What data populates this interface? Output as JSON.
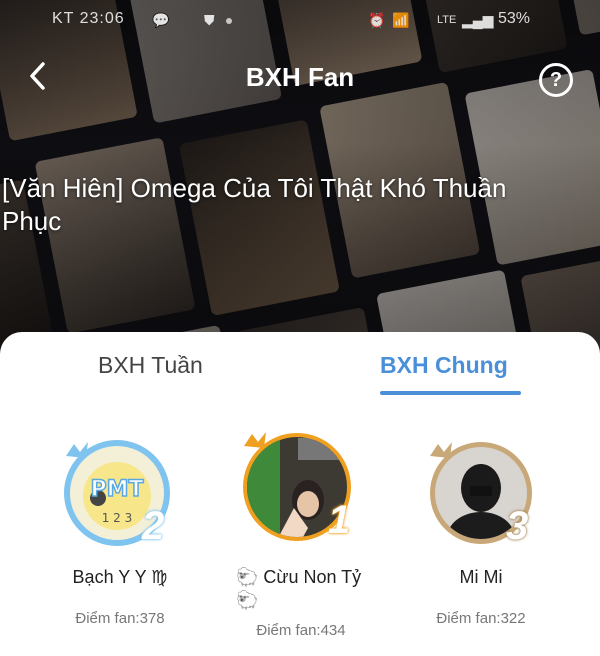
{
  "status_bar": {
    "left_text": "KT 23:06",
    "network": "LTE",
    "battery": "53%"
  },
  "header": {
    "title": "BXH Fan",
    "back_icon": "chevron-left-icon",
    "help_icon": "question-circle-icon",
    "help_glyph": "?"
  },
  "novel": {
    "title": "[Văn Hiên] Omega Của Tôi Thật Khó Thuần Phục"
  },
  "tabs": [
    {
      "label": "BXH Tuần",
      "active": false
    },
    {
      "label": "BXH Chung",
      "active": true
    }
  ],
  "colors": {
    "accent": "#4a90d9",
    "gold": "#f0a020",
    "silver": "#7fc4ef",
    "bronze": "#c8a878"
  },
  "ranking": [
    {
      "rank": "2",
      "name": "Bạch Y Y ♍",
      "score": "Điểm fan:378"
    },
    {
      "rank": "1",
      "name": "🐑 Cừu Non Tỷ 🐑",
      "score": "Điểm fan:434"
    },
    {
      "rank": "3",
      "name": "Mi Mi",
      "score": "Điểm fan:322"
    }
  ]
}
